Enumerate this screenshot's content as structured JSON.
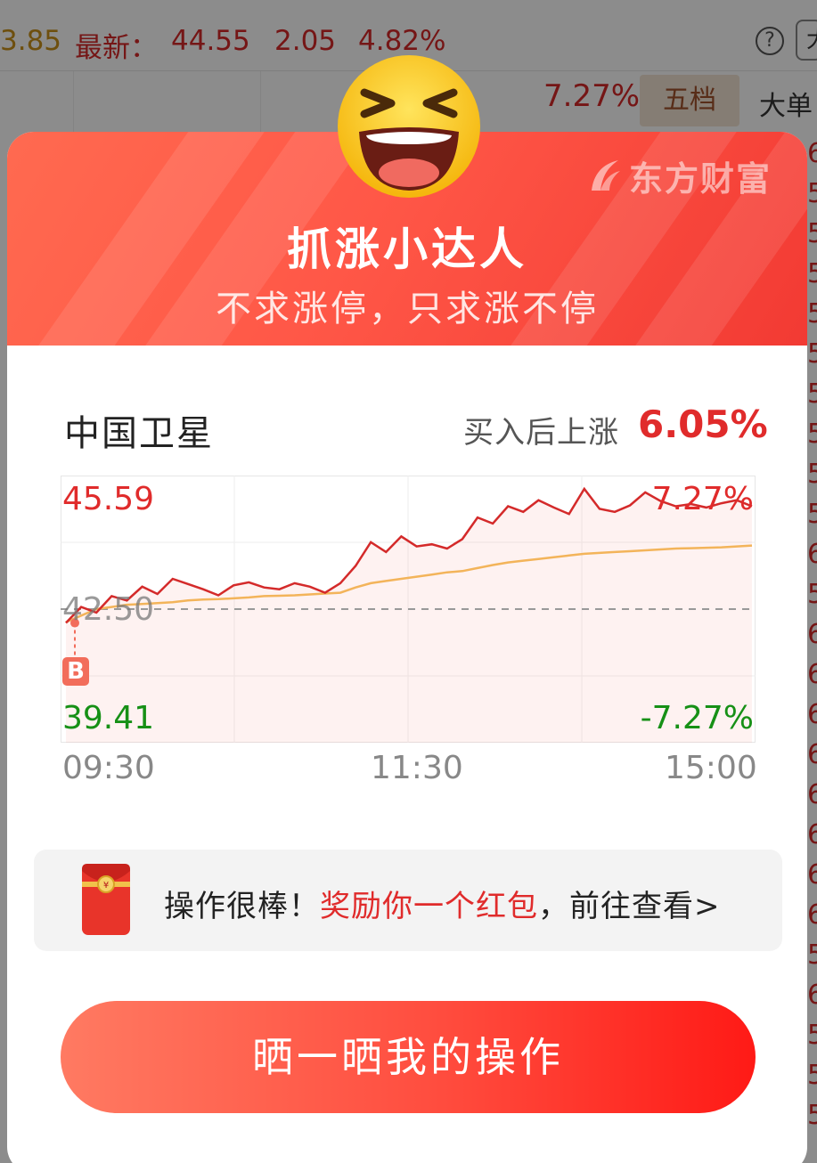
{
  "background": {
    "pre_close": "3.85",
    "latest_label": "最新：",
    "latest_value": "44.55",
    "change": "2.05",
    "change_pct": "4.82%",
    "high_pct": "7.27%",
    "tab_five": "五档",
    "tab_big": "大单"
  },
  "modal": {
    "brand": "东方财富",
    "title": "抓涨小达人",
    "subtitle": "不求涨停，只求涨不停",
    "stock_name": "中国卫星",
    "rise_label": "买入后上涨",
    "rise_value": "6.05%",
    "buy_marker": "B",
    "reward_text_a": "操作很棒！",
    "reward_text_b": "奖励你一个红包",
    "reward_text_c": "，前往查看>",
    "cta_label": "晒一晒我的操作"
  },
  "chart_data": {
    "type": "line",
    "title": "",
    "series": [],
    "y_max_label": "45.59",
    "y_max_pct": "7.27%",
    "y_mid_label": "42.50",
    "y_min_label": "39.41",
    "y_min_pct": "-7.27%",
    "ylim": [
      39.41,
      45.59
    ],
    "prev_close": 42.5,
    "x_ticks": [
      "09:30",
      "11:30",
      "15:00"
    ],
    "price": [
      42.18,
      42.55,
      42.42,
      42.8,
      42.7,
      43.02,
      42.85,
      43.2,
      43.08,
      42.96,
      42.82,
      43.05,
      43.12,
      43.0,
      42.96,
      43.1,
      43.02,
      42.88,
      43.1,
      43.5,
      44.05,
      43.82,
      44.18,
      43.95,
      44.0,
      43.9,
      44.12,
      44.62,
      44.48,
      44.88,
      44.75,
      45.02,
      44.85,
      44.7,
      45.28,
      44.82,
      44.75,
      44.9,
      45.2,
      45.0,
      44.88,
      44.93,
      44.85,
      44.95,
      45.02,
      44.88
    ],
    "avg": [
      42.2,
      42.35,
      42.5,
      42.55,
      42.6,
      42.62,
      42.64,
      42.66,
      42.7,
      42.72,
      42.73,
      42.75,
      42.77,
      42.8,
      42.81,
      42.82,
      42.84,
      42.86,
      42.88,
      43.0,
      43.1,
      43.15,
      43.2,
      43.25,
      43.3,
      43.35,
      43.38,
      43.45,
      43.52,
      43.58,
      43.62,
      43.66,
      43.7,
      43.74,
      43.78,
      43.8,
      43.82,
      43.84,
      43.86,
      43.88,
      43.9,
      43.91,
      43.92,
      43.93,
      43.95,
      43.97
    ],
    "buy_point": {
      "index": 0,
      "price": 42.18
    }
  }
}
